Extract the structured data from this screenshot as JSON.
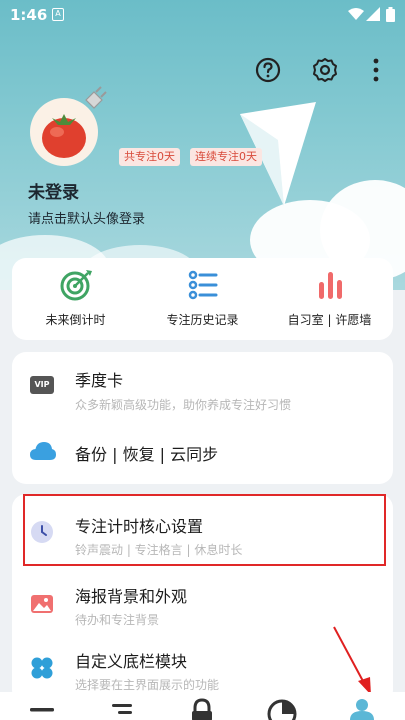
{
  "status": {
    "time": "1:46",
    "sim_label": "A"
  },
  "header": {
    "help_icon": "help-circle-icon",
    "settings_icon": "gear-icon",
    "more_icon": "more-vertical-icon",
    "avatar_icon": "tomato-icon",
    "badge_total": "共专注0天",
    "badge_streak": "连续专注0天",
    "login_title": "未登录",
    "login_hint": "请点击默认头像登录"
  },
  "quick_actions": [
    {
      "label": "未来倒计时",
      "icon": "target-icon"
    },
    {
      "label": "专注历史记录",
      "icon": "list-icon"
    },
    {
      "label": "自习室 | 许愿墙",
      "icon": "bar-chart-icon"
    }
  ],
  "menu_card1": [
    {
      "title": "季度卡",
      "subtitle": "众多新颖高级功能，助你养成专注好习惯",
      "icon": "vip-icon",
      "icon_text": "VIP"
    },
    {
      "title": "备份 | 恢复 | 云同步",
      "subtitle": "",
      "icon": "cloud-icon"
    }
  ],
  "menu_card2": [
    {
      "title": "专注计时核心设置",
      "subtitle": "铃声震动 | 专注格言 | 休息时长",
      "icon": "clock-icon"
    },
    {
      "title": "海报背景和外观",
      "subtitle": "待办和专注背景",
      "icon": "image-icon"
    },
    {
      "title": "自定义底栏模块",
      "subtitle": "选择要在主界面展示的功能",
      "icon": "clover-icon"
    }
  ],
  "tabs": [
    {
      "icon": "menu-icon"
    },
    {
      "icon": "list-icon"
    },
    {
      "icon": "lock-icon"
    },
    {
      "icon": "pie-chart-icon"
    },
    {
      "icon": "user-icon"
    }
  ],
  "colors": {
    "accent_teal": "#3bb3c3",
    "badge_red": "#d84a3a",
    "highlight_red": "#e02828",
    "green": "#3fa463",
    "blue": "#3a8fd8",
    "coral": "#f06a6a"
  }
}
